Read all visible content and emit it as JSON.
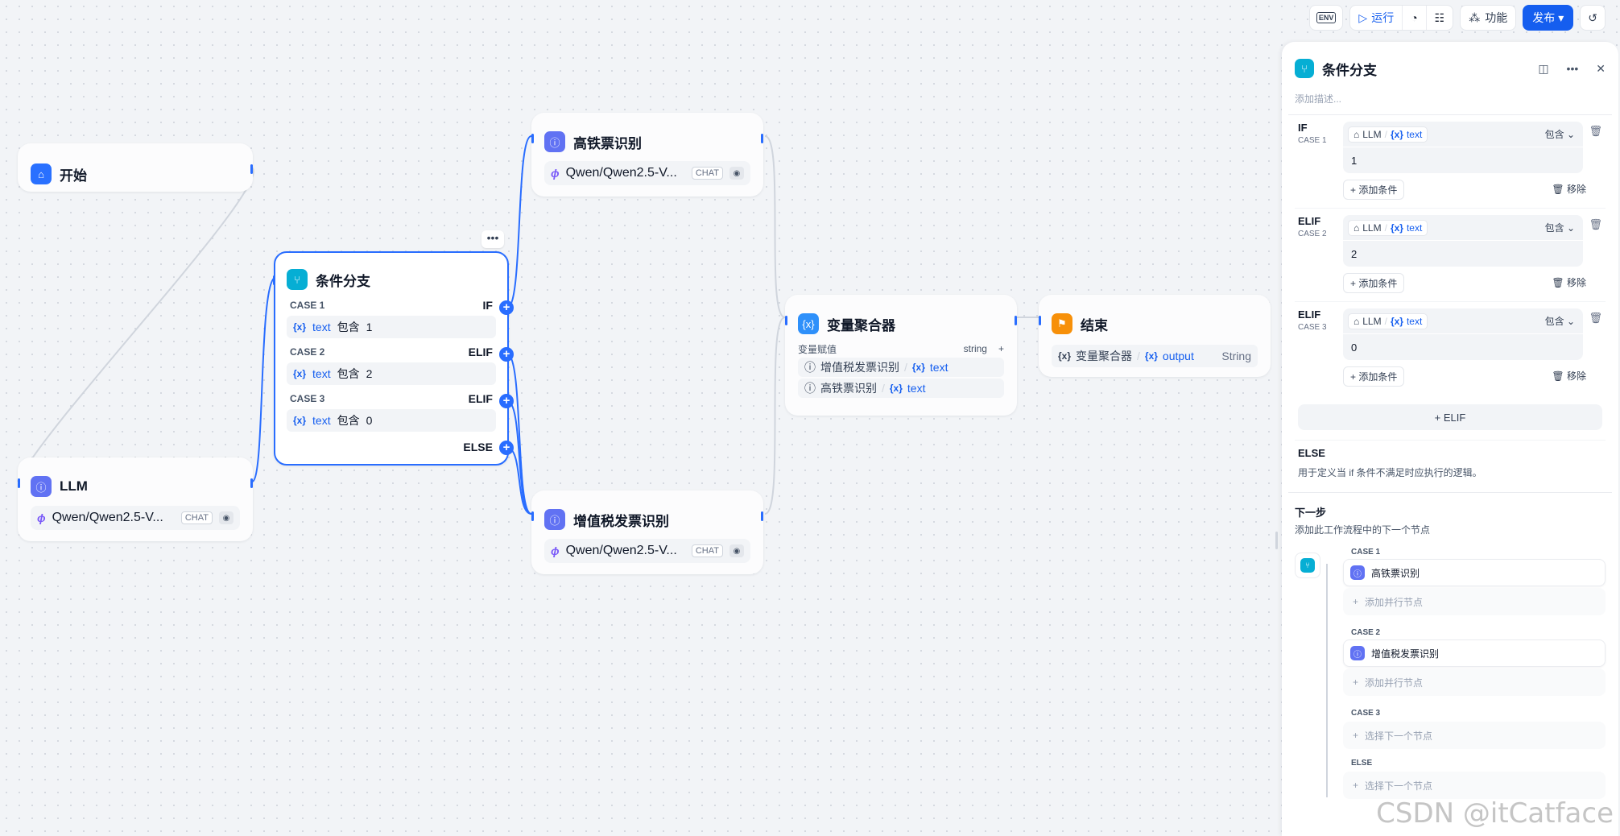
{
  "toolbar": {
    "env": "ENV",
    "run": "运行",
    "features": "功能",
    "publish": "发布"
  },
  "nodes": {
    "start": {
      "title": "开始"
    },
    "llm": {
      "title": "LLM",
      "model": "Qwen/Qwen2.5-V...",
      "mode": "CHAT"
    },
    "ifelse": {
      "title": "条件分支",
      "cases": [
        {
          "case": "CASE 1",
          "kw": "IF",
          "var": "text",
          "op": "包含",
          "val": "1"
        },
        {
          "case": "CASE 2",
          "kw": "ELIF",
          "var": "text",
          "op": "包含",
          "val": "2"
        },
        {
          "case": "CASE 3",
          "kw": "ELIF",
          "var": "text",
          "op": "包含",
          "val": "0"
        }
      ],
      "else": "ELSE"
    },
    "train": {
      "title": "高铁票识别",
      "model": "Qwen/Qwen2.5-V...",
      "mode": "CHAT"
    },
    "vat": {
      "title": "增值税发票识别",
      "model": "Qwen/Qwen2.5-V...",
      "mode": "CHAT"
    },
    "agg": {
      "title": "变量聚合器",
      "label": "变量赋值",
      "type": "string",
      "items": [
        {
          "node": "增值税发票识别",
          "var": "text"
        },
        {
          "node": "高铁票识别",
          "var": "text"
        }
      ]
    },
    "end": {
      "title": "结束",
      "src": "变量聚合器",
      "var": "output",
      "type": "String"
    }
  },
  "panel": {
    "title": "条件分支",
    "desc": "添加描述...",
    "cases": [
      {
        "kw": "IF",
        "case": "CASE 1",
        "node": "LLM",
        "var": "text",
        "op": "包含",
        "val": "1"
      },
      {
        "kw": "ELIF",
        "case": "CASE 2",
        "node": "LLM",
        "var": "text",
        "op": "包含",
        "val": "2"
      },
      {
        "kw": "ELIF",
        "case": "CASE 3",
        "node": "LLM",
        "var": "text",
        "op": "包含",
        "val": "0"
      }
    ],
    "add_condition": "添加条件",
    "remove": "移除",
    "add_elif": "ELIF",
    "else_title": "ELSE",
    "else_desc": "用于定义当 if 条件不满足时应执行的逻辑。",
    "next_title": "下一步",
    "next_desc": "添加此工作流程中的下一个节点",
    "branches": [
      {
        "label": "CASE 1",
        "node": "高铁票识别",
        "add": "添加并行节点"
      },
      {
        "label": "CASE 2",
        "node": "增值税发票识别",
        "add": "添加并行节点"
      },
      {
        "label": "CASE 3",
        "add": "选择下一个节点"
      },
      {
        "label": "ELSE",
        "add": "选择下一个节点"
      }
    ]
  },
  "watermark": "CSDN @itCatface",
  "colors": {
    "accent": "#155eef",
    "edge": "#296dff",
    "edge_inactive": "#d0d5dd"
  }
}
